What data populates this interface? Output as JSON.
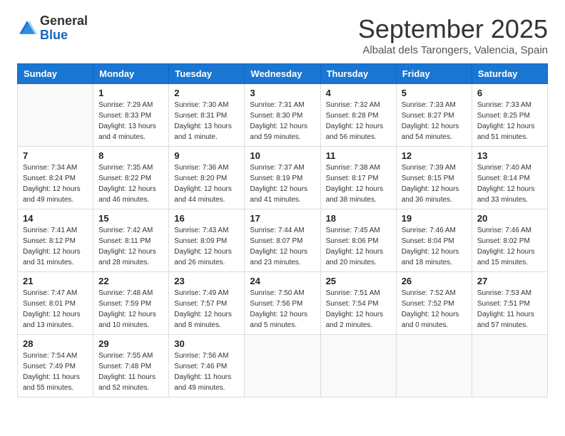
{
  "logo": {
    "general": "General",
    "blue": "Blue"
  },
  "header": {
    "month": "September 2025",
    "location": "Albalat dels Tarongers, Valencia, Spain"
  },
  "weekdays": [
    "Sunday",
    "Monday",
    "Tuesday",
    "Wednesday",
    "Thursday",
    "Friday",
    "Saturday"
  ],
  "weeks": [
    [
      {
        "day": "",
        "empty": true
      },
      {
        "day": "1",
        "sunrise": "Sunrise: 7:29 AM",
        "sunset": "Sunset: 8:33 PM",
        "daylight": "Daylight: 13 hours and 4 minutes."
      },
      {
        "day": "2",
        "sunrise": "Sunrise: 7:30 AM",
        "sunset": "Sunset: 8:31 PM",
        "daylight": "Daylight: 13 hours and 1 minute."
      },
      {
        "day": "3",
        "sunrise": "Sunrise: 7:31 AM",
        "sunset": "Sunset: 8:30 PM",
        "daylight": "Daylight: 12 hours and 59 minutes."
      },
      {
        "day": "4",
        "sunrise": "Sunrise: 7:32 AM",
        "sunset": "Sunset: 8:28 PM",
        "daylight": "Daylight: 12 hours and 56 minutes."
      },
      {
        "day": "5",
        "sunrise": "Sunrise: 7:33 AM",
        "sunset": "Sunset: 8:27 PM",
        "daylight": "Daylight: 12 hours and 54 minutes."
      },
      {
        "day": "6",
        "sunrise": "Sunrise: 7:33 AM",
        "sunset": "Sunset: 8:25 PM",
        "daylight": "Daylight: 12 hours and 51 minutes."
      }
    ],
    [
      {
        "day": "7",
        "sunrise": "Sunrise: 7:34 AM",
        "sunset": "Sunset: 8:24 PM",
        "daylight": "Daylight: 12 hours and 49 minutes."
      },
      {
        "day": "8",
        "sunrise": "Sunrise: 7:35 AM",
        "sunset": "Sunset: 8:22 PM",
        "daylight": "Daylight: 12 hours and 46 minutes."
      },
      {
        "day": "9",
        "sunrise": "Sunrise: 7:36 AM",
        "sunset": "Sunset: 8:20 PM",
        "daylight": "Daylight: 12 hours and 44 minutes."
      },
      {
        "day": "10",
        "sunrise": "Sunrise: 7:37 AM",
        "sunset": "Sunset: 8:19 PM",
        "daylight": "Daylight: 12 hours and 41 minutes."
      },
      {
        "day": "11",
        "sunrise": "Sunrise: 7:38 AM",
        "sunset": "Sunset: 8:17 PM",
        "daylight": "Daylight: 12 hours and 38 minutes."
      },
      {
        "day": "12",
        "sunrise": "Sunrise: 7:39 AM",
        "sunset": "Sunset: 8:15 PM",
        "daylight": "Daylight: 12 hours and 36 minutes."
      },
      {
        "day": "13",
        "sunrise": "Sunrise: 7:40 AM",
        "sunset": "Sunset: 8:14 PM",
        "daylight": "Daylight: 12 hours and 33 minutes."
      }
    ],
    [
      {
        "day": "14",
        "sunrise": "Sunrise: 7:41 AM",
        "sunset": "Sunset: 8:12 PM",
        "daylight": "Daylight: 12 hours and 31 minutes."
      },
      {
        "day": "15",
        "sunrise": "Sunrise: 7:42 AM",
        "sunset": "Sunset: 8:11 PM",
        "daylight": "Daylight: 12 hours and 28 minutes."
      },
      {
        "day": "16",
        "sunrise": "Sunrise: 7:43 AM",
        "sunset": "Sunset: 8:09 PM",
        "daylight": "Daylight: 12 hours and 26 minutes."
      },
      {
        "day": "17",
        "sunrise": "Sunrise: 7:44 AM",
        "sunset": "Sunset: 8:07 PM",
        "daylight": "Daylight: 12 hours and 23 minutes."
      },
      {
        "day": "18",
        "sunrise": "Sunrise: 7:45 AM",
        "sunset": "Sunset: 8:06 PM",
        "daylight": "Daylight: 12 hours and 20 minutes."
      },
      {
        "day": "19",
        "sunrise": "Sunrise: 7:46 AM",
        "sunset": "Sunset: 8:04 PM",
        "daylight": "Daylight: 12 hours and 18 minutes."
      },
      {
        "day": "20",
        "sunrise": "Sunrise: 7:46 AM",
        "sunset": "Sunset: 8:02 PM",
        "daylight": "Daylight: 12 hours and 15 minutes."
      }
    ],
    [
      {
        "day": "21",
        "sunrise": "Sunrise: 7:47 AM",
        "sunset": "Sunset: 8:01 PM",
        "daylight": "Daylight: 12 hours and 13 minutes."
      },
      {
        "day": "22",
        "sunrise": "Sunrise: 7:48 AM",
        "sunset": "Sunset: 7:59 PM",
        "daylight": "Daylight: 12 hours and 10 minutes."
      },
      {
        "day": "23",
        "sunrise": "Sunrise: 7:49 AM",
        "sunset": "Sunset: 7:57 PM",
        "daylight": "Daylight: 12 hours and 8 minutes."
      },
      {
        "day": "24",
        "sunrise": "Sunrise: 7:50 AM",
        "sunset": "Sunset: 7:56 PM",
        "daylight": "Daylight: 12 hours and 5 minutes."
      },
      {
        "day": "25",
        "sunrise": "Sunrise: 7:51 AM",
        "sunset": "Sunset: 7:54 PM",
        "daylight": "Daylight: 12 hours and 2 minutes."
      },
      {
        "day": "26",
        "sunrise": "Sunrise: 7:52 AM",
        "sunset": "Sunset: 7:52 PM",
        "daylight": "Daylight: 12 hours and 0 minutes."
      },
      {
        "day": "27",
        "sunrise": "Sunrise: 7:53 AM",
        "sunset": "Sunset: 7:51 PM",
        "daylight": "Daylight: 11 hours and 57 minutes."
      }
    ],
    [
      {
        "day": "28",
        "sunrise": "Sunrise: 7:54 AM",
        "sunset": "Sunset: 7:49 PM",
        "daylight": "Daylight: 11 hours and 55 minutes."
      },
      {
        "day": "29",
        "sunrise": "Sunrise: 7:55 AM",
        "sunset": "Sunset: 7:48 PM",
        "daylight": "Daylight: 11 hours and 52 minutes."
      },
      {
        "day": "30",
        "sunrise": "Sunrise: 7:56 AM",
        "sunset": "Sunset: 7:46 PM",
        "daylight": "Daylight: 11 hours and 49 minutes."
      },
      {
        "day": "",
        "empty": true
      },
      {
        "day": "",
        "empty": true
      },
      {
        "day": "",
        "empty": true
      },
      {
        "day": "",
        "empty": true
      }
    ]
  ]
}
